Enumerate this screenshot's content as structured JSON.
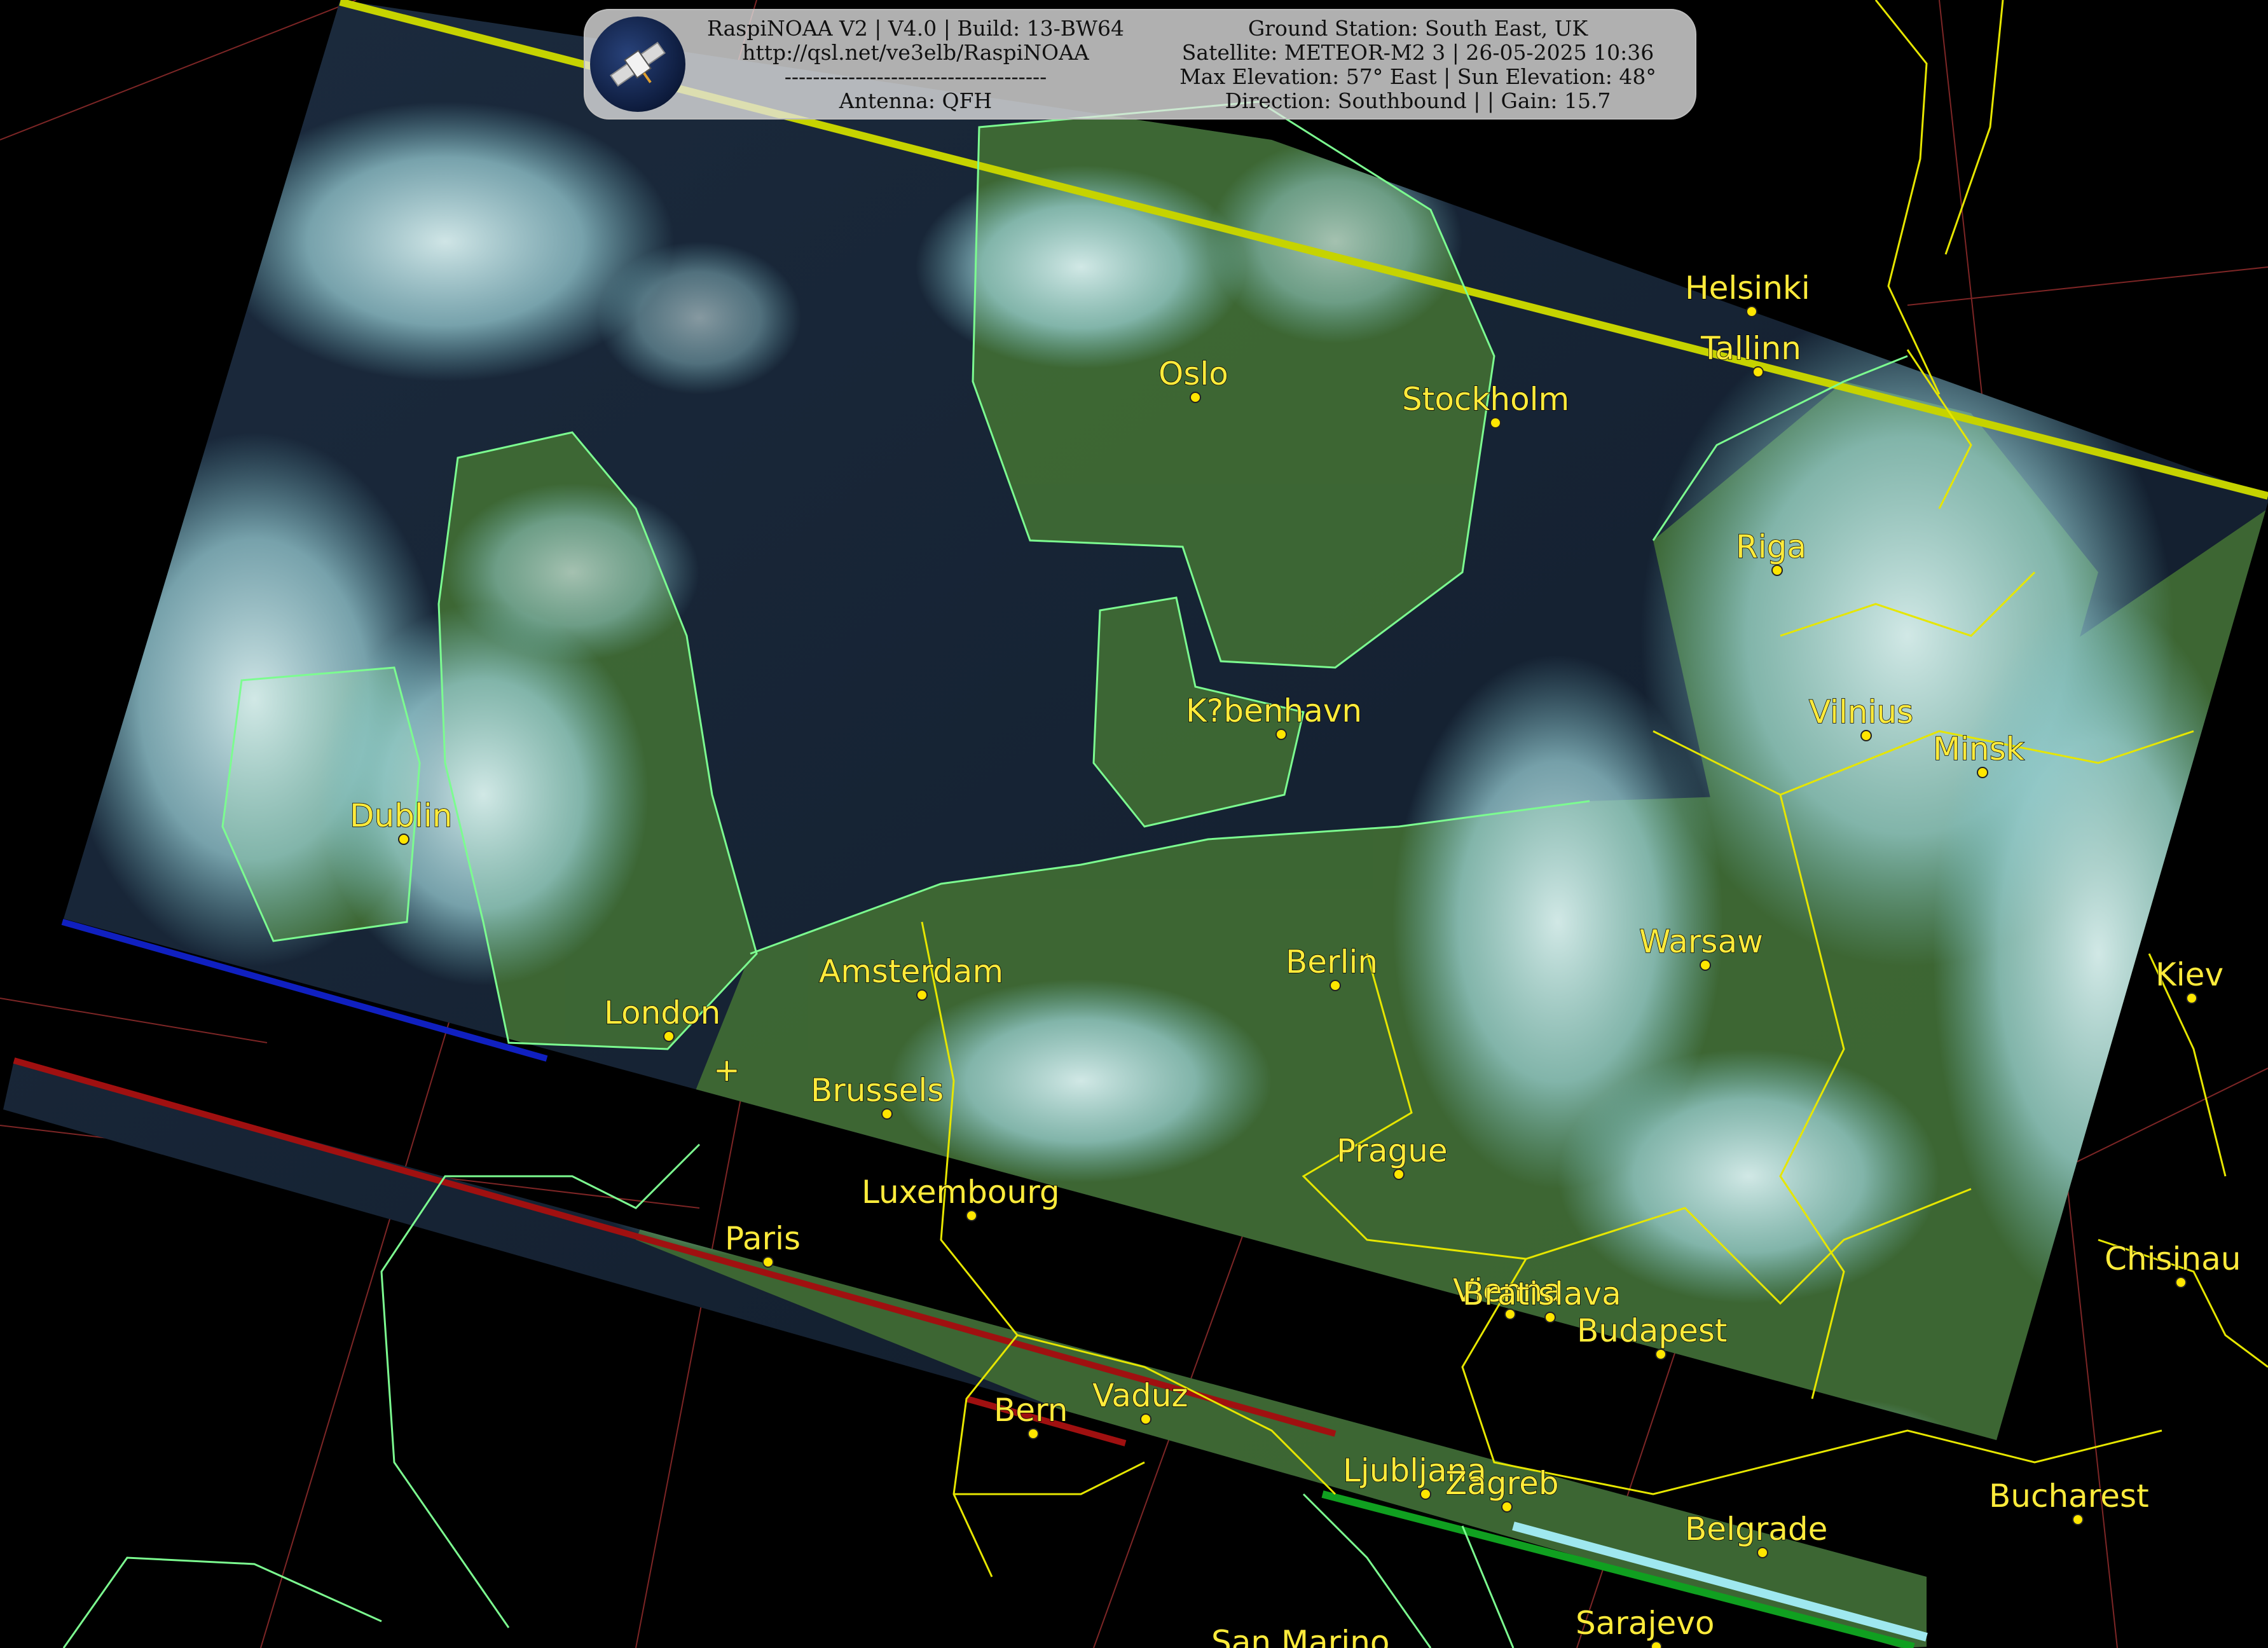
{
  "banner": {
    "left_lines": [
      "RaspiNOAA V2 | V4.0 | Build: 13-BW64",
      "http://qsl.net/ve3elb/RaspiNOAA",
      "-------------------------------------",
      "Antenna: QFH"
    ],
    "right_lines": [
      "Ground Station: South East, UK",
      "Satellite: METEOR-M2 3 | 26-05-2025 10:36",
      "Max Elevation: 57° East | Sun Elevation: 48°",
      "Direction: Southbound | | Gain: 15.7"
    ]
  },
  "cities": [
    {
      "name": "Helsinki"
    },
    {
      "name": "Tallinn"
    },
    {
      "name": "Oslo"
    },
    {
      "name": "Stockholm"
    },
    {
      "name": "Riga"
    },
    {
      "name": "K?benhavn"
    },
    {
      "name": "Vilnius"
    },
    {
      "name": "Minsk"
    },
    {
      "name": "Dublin"
    },
    {
      "name": "Amsterdam"
    },
    {
      "name": "Berlin"
    },
    {
      "name": "Warsaw"
    },
    {
      "name": "Kiev"
    },
    {
      "name": "London"
    },
    {
      "name": "Brussels"
    },
    {
      "name": "Prague"
    },
    {
      "name": "Luxembourg"
    },
    {
      "name": "Paris"
    },
    {
      "name": "Chisinau"
    },
    {
      "name": "Vienna"
    },
    {
      "name": "Bratislava"
    },
    {
      "name": "Budapest"
    },
    {
      "name": "Bern"
    },
    {
      "name": "Vaduz"
    },
    {
      "name": "Bucharest"
    },
    {
      "name": "Ljubljana"
    },
    {
      "name": "Zagreb"
    },
    {
      "name": "Belgrade"
    },
    {
      "name": "Sarajevo"
    },
    {
      "name": "San Marino"
    }
  ],
  "colors": {
    "coastline": "#7CFC90",
    "borders": "#e6e600",
    "graticule": "#b03030",
    "city_label": "#ffeb3b"
  }
}
